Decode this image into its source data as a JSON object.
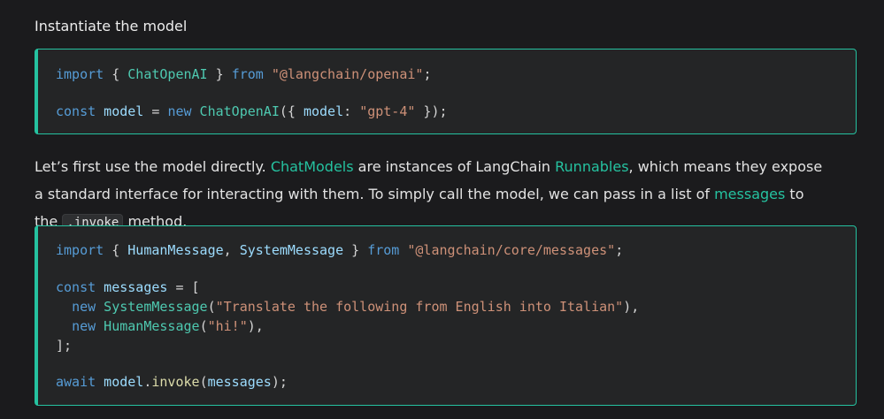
{
  "heading": "Instantiate the model",
  "code_block_1": {
    "line1": {
      "kw_import": "import",
      "brace_open": " { ",
      "cls_name": "ChatOpenAI",
      "brace_close": " } ",
      "kw_from": "from",
      "space": " ",
      "str_module": "\"@langchain/openai\"",
      "semi": ";"
    },
    "line2": {
      "kw_const": "const",
      "id_model": " model",
      "eq": " = ",
      "kw_new": "new",
      "cls_name": " ChatOpenAI",
      "open": "({ ",
      "key": "model",
      "colon": ": ",
      "str_val": "\"gpt-4\"",
      "close": " });"
    }
  },
  "paragraph": {
    "t1": "Let’s first use the model directly. ",
    "link1": "ChatModels",
    "t2": " are instances of LangChain ",
    "link2": "Runnables",
    "t3": ", which means they expose a standard interface for interacting with them. To simply call the model, we can pass in a list of ",
    "link3": "messages",
    "t4": " to the ",
    "code": ".invoke",
    "t5": " method."
  },
  "code_block_2": {
    "line1": {
      "kw_import": "import",
      "brace_open": " { ",
      "cls1": "HumanMessage",
      "comma": ", ",
      "cls2": "SystemMessage",
      "brace_close": " } ",
      "kw_from": "from",
      "space": " ",
      "str_module": "\"@langchain/core/messages\"",
      "semi": ";"
    },
    "line2": {
      "kw_const": "const",
      "id_messages": " messages",
      "rest": " = ["
    },
    "line3": {
      "indent": "  ",
      "kw_new": "new",
      "cls": " SystemMessage",
      "open": "(",
      "str": "\"Translate the following from English into Italian\"",
      "close": "),"
    },
    "line4": {
      "indent": "  ",
      "kw_new": "new",
      "cls": " HumanMessage",
      "open": "(",
      "str": "\"hi!\"",
      "close": "),"
    },
    "line5": {
      "text": "];"
    },
    "line6": {
      "kw_await": "await",
      "id_model": " model",
      "dot": ".",
      "fn": "invoke",
      "open": "(",
      "arg": "messages",
      "close": ");"
    }
  },
  "colors": {
    "accent": "#25c2a0",
    "keyword": "#569cd6",
    "class": "#4ec9b0",
    "string": "#ce9178",
    "function": "#dcdcaa",
    "identifier": "#9cdcfe"
  }
}
